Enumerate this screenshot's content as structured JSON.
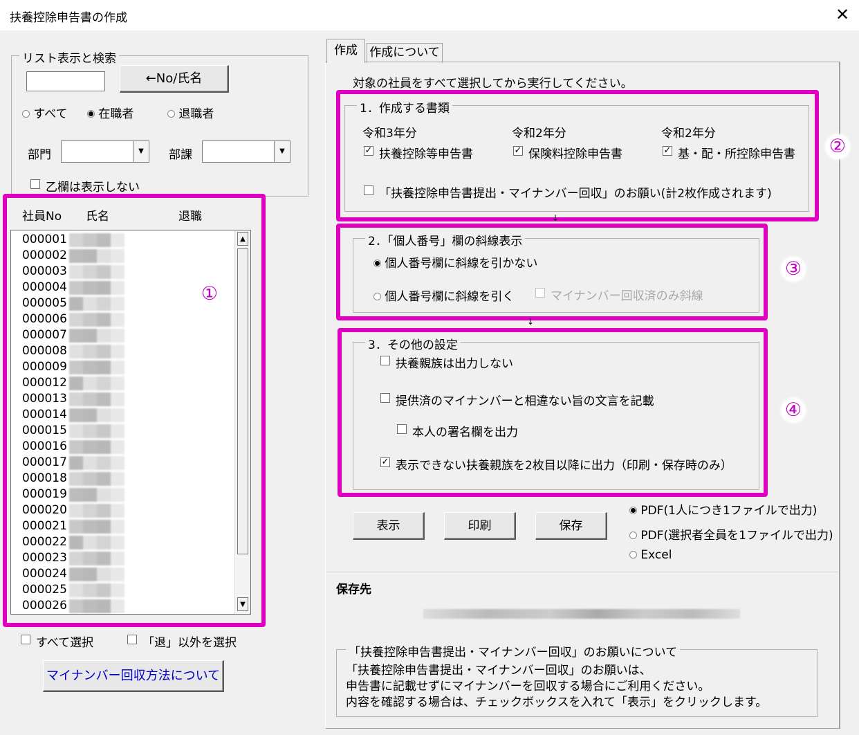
{
  "window": {
    "title": "扶養控除申告書の作成"
  },
  "left": {
    "search_group_label": "リスト表示と検索",
    "search_value": "",
    "search_button": "←No/氏名",
    "filters": [
      {
        "label": "すべて",
        "selected": false
      },
      {
        "label": "在職者",
        "selected": true
      },
      {
        "label": "退職者",
        "selected": false
      }
    ],
    "dept_label": "部門",
    "section_label": "部課",
    "hide_otsu_label": "乙欄は表示しない",
    "columns": [
      "社員No",
      "氏名",
      "退職"
    ],
    "employees": [
      "000001",
      "000002",
      "000003",
      "000004",
      "000005",
      "000006",
      "000007",
      "000008",
      "000009",
      "000012",
      "000013",
      "000014",
      "000015",
      "000016",
      "000017",
      "000018",
      "000019",
      "000020",
      "000021",
      "000022",
      "000023",
      "000024",
      "000025",
      "000026"
    ],
    "select_all_label": "すべて選択",
    "select_non_retired_label": "「退」以外を選択",
    "mynumber_method_button": "マイナンバー回収方法について"
  },
  "tabs": [
    {
      "label": "作成",
      "active": true
    },
    {
      "label": "作成について",
      "active": false
    }
  ],
  "main": {
    "instruction": "対象の社員をすべて選択してから実行してください。",
    "section1": {
      "title": "1．作成する書類",
      "docs": [
        {
          "year": "令和3年分",
          "label": "扶養控除等申告書",
          "checked": true
        },
        {
          "year": "令和2年分",
          "label": "保険料控除申告書",
          "checked": true
        },
        {
          "year": "令和2年分",
          "label": "基・配・所控除申告書",
          "checked": true
        }
      ],
      "request_label": "「扶養控除申告書提出・マイナンバー回収」のお願い(計2枚作成されます)",
      "request_checked": false
    },
    "section2": {
      "title": "2．「個人番号」欄の斜線表示",
      "opt_no_line": "個人番号欄に斜線を引かない",
      "opt_line": "個人番号欄に斜線を引く",
      "only_collected": "マイナンバー回収済のみ斜線",
      "selected": "no_line"
    },
    "section3": {
      "title": "3．その他の設定",
      "no_dependents": "扶養親族は出力しない",
      "statement": "提供済のマイナンバーと相違ない旨の文言を記載",
      "signature": "本人の署名欄を出力",
      "overflow": "表示できない扶養親族を2枚目以降に出力（印刷・保存時のみ）",
      "overflow_checked": true
    },
    "buttons": {
      "display": "表示",
      "print": "印刷",
      "save": "保存"
    },
    "output_options": [
      {
        "label": "PDF(1人につき1ファイルで出力)",
        "selected": true
      },
      {
        "label": "PDF(選択者全員を1ファイルで出力)",
        "selected": false
      },
      {
        "label": "Excel",
        "selected": false
      }
    ],
    "save_dest_label": "保存先",
    "note": {
      "title": "「扶養控除申告書提出・マイナンバー回収」のお願いについて",
      "lines": [
        "「扶養控除申告書提出・マイナンバー回収」のお願いは、",
        "申告書に記載せずにマイナンバーを回収する場合にご利用ください。",
        "内容を確認する場合は、チェックボックスを入れて「表示」をクリックします。"
      ]
    }
  },
  "annotations": [
    "①",
    "②",
    "③",
    "④"
  ],
  "accent_color": "#e000c0"
}
